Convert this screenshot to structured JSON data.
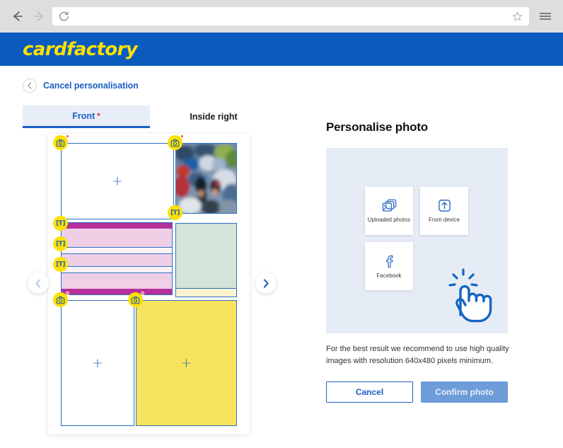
{
  "browser": {
    "back_icon": "arrow-left-icon",
    "forward_icon": "arrow-right-icon",
    "reload_icon": "reload-icon",
    "url_value": "",
    "url_placeholder": "",
    "bookmark_icon": "star-icon",
    "menu_icon": "hamburger-menu-icon"
  },
  "header": {
    "brand": "cardfactory",
    "brand_color": "#ffe100",
    "bar_color": "#0a5bbd"
  },
  "toolbar": {
    "cancel_label": "Cancel personalisation",
    "back_chevron_icon": "chevron-left-icon"
  },
  "tabs": [
    {
      "label": "Front",
      "required": "*",
      "active": true
    },
    {
      "label": "Inside right",
      "required": "",
      "active": false
    }
  ],
  "preview": {
    "prev_icon": "chevron-left-icon",
    "next_icon": "chevron-right-icon",
    "add_photo_glyph": "+",
    "badges": [
      {
        "type": "photo",
        "label": "camera-icon",
        "has_alert": true
      },
      {
        "type": "photo",
        "label": "camera-icon",
        "has_alert": true
      },
      {
        "type": "text",
        "label": "[T]",
        "has_alert": false
      },
      {
        "type": "text",
        "label": "[T]",
        "has_alert": false
      },
      {
        "type": "text",
        "label": "[T]",
        "has_alert": false
      },
      {
        "type": "text",
        "label": "[T]",
        "has_alert": false
      },
      {
        "type": "photo",
        "label": "camera-icon",
        "has_alert": true
      },
      {
        "type": "photo",
        "label": "camera-icon",
        "has_alert": true
      }
    ],
    "colors": {
      "zone_border": "#2e6fc4",
      "text_block": "#efcfe6",
      "text_stripe": "#b6309b",
      "green_block": "#d3e4d8",
      "yellow_block": "#f7e45c"
    }
  },
  "panel": {
    "title": "Personalise photo",
    "options": [
      {
        "label": "Uploaded photos",
        "icon": "photos-stack-icon"
      },
      {
        "label": "From device",
        "icon": "upload-icon"
      },
      {
        "label": "Facebook",
        "icon": "facebook-icon"
      }
    ],
    "hint": "For the best result we recommend to use high quality images with resolution 640x480 pixels minimum.",
    "cancel_button": "Cancel",
    "confirm_button": "Confirm photo",
    "cursor_icon": "click-hand-icon",
    "accent_color": "#1c5fc4"
  }
}
